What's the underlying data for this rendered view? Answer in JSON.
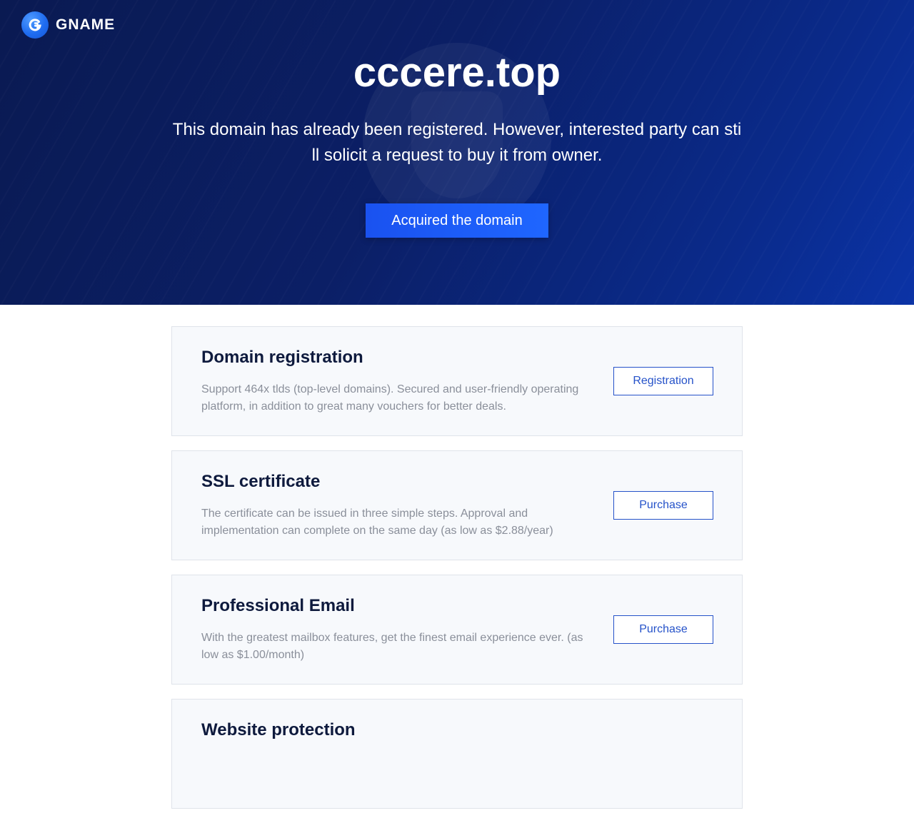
{
  "brand": {
    "logo_text": "GNAME",
    "accent_color": "#1f66ff"
  },
  "hero": {
    "title": "cccere.top",
    "description": "This domain has already been registered. However, interested party can still solicit a request to buy it from owner.",
    "button_label": "Acquired the domain"
  },
  "cards": [
    {
      "title": "Domain registration",
      "description": "Support 464x tlds (top-level domains). Secured and user-friendly operating platform, in addition to great many vouchers for better deals.",
      "button_label": "Registration"
    },
    {
      "title": "SSL certificate",
      "description": "The certificate can be issued in three simple steps. Approval and implementation can complete on the same day (as low as $2.88/year)",
      "button_label": "Purchase"
    },
    {
      "title": "Professional Email",
      "description": "With the greatest mailbox features, get the finest email experience ever. (as low as $1.00/month)",
      "button_label": "Purchase"
    },
    {
      "title": "Website protection"
    }
  ]
}
